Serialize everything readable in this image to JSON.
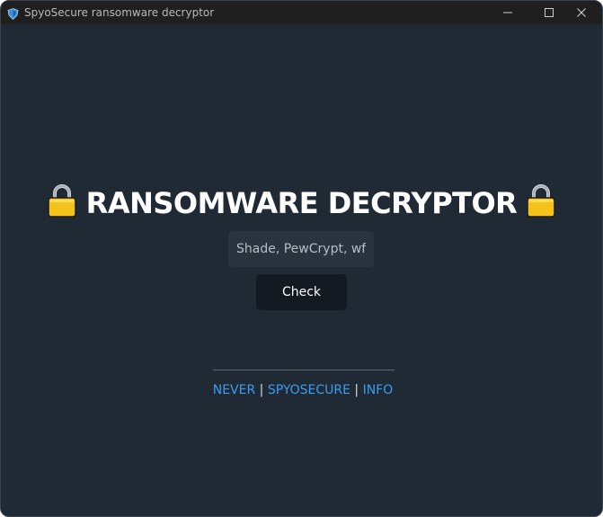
{
  "window": {
    "title": "SpyoSecure ransomware decryptor",
    "icon": "app-shield-icon",
    "controls": [
      "minimize-icon",
      "maximize-icon",
      "close-icon"
    ]
  },
  "main": {
    "heading": "RANSOMWARE DECRYPTOR",
    "heading_icon": "lock-icon",
    "search": {
      "placeholder": "Shade, PewCrypt, wfl",
      "value": ""
    },
    "check_label": "Check"
  },
  "footer": {
    "links": [
      "NEVER",
      "SPYOSECURE",
      "INFO"
    ],
    "separator": "|"
  },
  "colors": {
    "background": "#202a35",
    "titlebar": "#1f1f1f",
    "link": "#3b9cf0",
    "button": "#141a21",
    "lock_body": "#f4c21a"
  }
}
